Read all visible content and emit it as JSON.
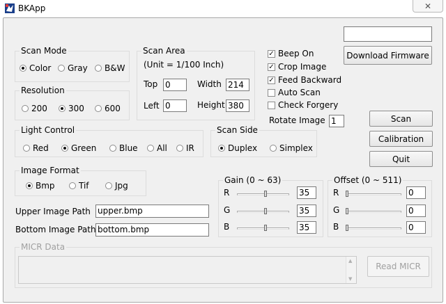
{
  "window": {
    "title": "BKApp",
    "close": "✕"
  },
  "top_box": {
    "value": ""
  },
  "download_firmware": "Download Firmware",
  "scan_mode": {
    "title": "Scan Mode",
    "options": [
      {
        "label": "Color",
        "checked": true
      },
      {
        "label": "Gray",
        "checked": false
      },
      {
        "label": "B&W",
        "checked": false
      }
    ]
  },
  "scan_area": {
    "title": "Scan Area",
    "unit": "(Unit = 1/100 Inch)",
    "top_label": "Top",
    "top_value": "0",
    "left_label": "Left",
    "left_value": "0",
    "width_label": "Width",
    "width_value": "214",
    "height_label": "Height",
    "height_value": "380"
  },
  "options": {
    "beep_on": {
      "label": "Beep On",
      "checked": true
    },
    "crop_image": {
      "label": "Crop Image",
      "checked": true
    },
    "feed_backward": {
      "label": "Feed Backward",
      "checked": true
    },
    "auto_scan": {
      "label": "Auto Scan",
      "checked": false
    },
    "check_forgery": {
      "label": "Check Forgery",
      "checked": false
    }
  },
  "rotate": {
    "label": "Rotate Image",
    "value": "1"
  },
  "resolution": {
    "title": "Resolution",
    "options": [
      {
        "label": "200",
        "checked": false
      },
      {
        "label": "300",
        "checked": true
      },
      {
        "label": "600",
        "checked": false
      }
    ]
  },
  "buttons": {
    "scan": "Scan",
    "calibration": "Calibration",
    "quit": "Quit",
    "read_micr": "Read MICR"
  },
  "light_control": {
    "title": "Light Control",
    "options": [
      {
        "label": "Red",
        "checked": false
      },
      {
        "label": "Green",
        "checked": true
      },
      {
        "label": "Blue",
        "checked": false
      },
      {
        "label": "All",
        "checked": false
      },
      {
        "label": "IR",
        "checked": false
      }
    ]
  },
  "scan_side": {
    "title": "Scan Side",
    "options": [
      {
        "label": "Duplex",
        "checked": true
      },
      {
        "label": "Simplex",
        "checked": false
      }
    ]
  },
  "image_format": {
    "title": "Image Format",
    "options": [
      {
        "label": "Bmp",
        "checked": true
      },
      {
        "label": "Tif",
        "checked": false
      },
      {
        "label": "Jpg",
        "checked": false
      }
    ]
  },
  "paths": {
    "upper_label": "Upper Image Path",
    "upper_value": "upper.bmp",
    "bottom_label": "Bottom Image Path",
    "bottom_value": "bottom.bmp"
  },
  "gain": {
    "title": "Gain (0 ~ 63)",
    "channels": [
      {
        "label": "R",
        "value": "35",
        "level": 0.556
      },
      {
        "label": "G",
        "value": "35",
        "level": 0.556
      },
      {
        "label": "B",
        "value": "35",
        "level": 0.556
      }
    ]
  },
  "offset": {
    "title": "Offset (0 ~ 511)",
    "channels": [
      {
        "label": "R",
        "value": "0",
        "level": 0
      },
      {
        "label": "G",
        "value": "0",
        "level": 0
      },
      {
        "label": "B",
        "value": "0",
        "level": 0
      }
    ]
  },
  "micr": {
    "title": "MICR Data",
    "value": "",
    "scroll_up": "▲",
    "scroll_down": "▼"
  }
}
